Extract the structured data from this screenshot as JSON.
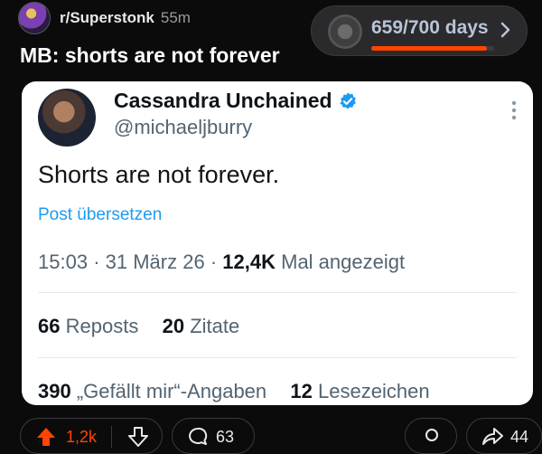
{
  "header": {
    "subreddit": "r/Superstonk",
    "post_age": "55m",
    "title": "MB: shorts are not forever"
  },
  "days_badge": {
    "text": "659/700 days",
    "progress": 0.941
  },
  "tweet": {
    "display_name": "Cassandra Unchained",
    "handle": "@michaeljburry",
    "text": "Shorts are not forever.",
    "translate_label": "Post übersetzen",
    "time": "15:03",
    "date": "31 März 26",
    "views_count": "12,4K",
    "views_label": "Mal angezeigt",
    "reposts_count": "66",
    "reposts_label": "Reposts",
    "quotes_count": "20",
    "quotes_label": "Zitate",
    "likes_count": "390",
    "likes_label": "„Gefällt mir“-Angaben",
    "bookmarks_count": "12",
    "bookmarks_label": "Lesezeichen"
  },
  "actions": {
    "upvotes": "1,2k",
    "comments": "63",
    "shares": "44"
  },
  "colors": {
    "accent": "#ff4500",
    "link": "#1d9bf0",
    "verified": "#1d9bf0"
  }
}
